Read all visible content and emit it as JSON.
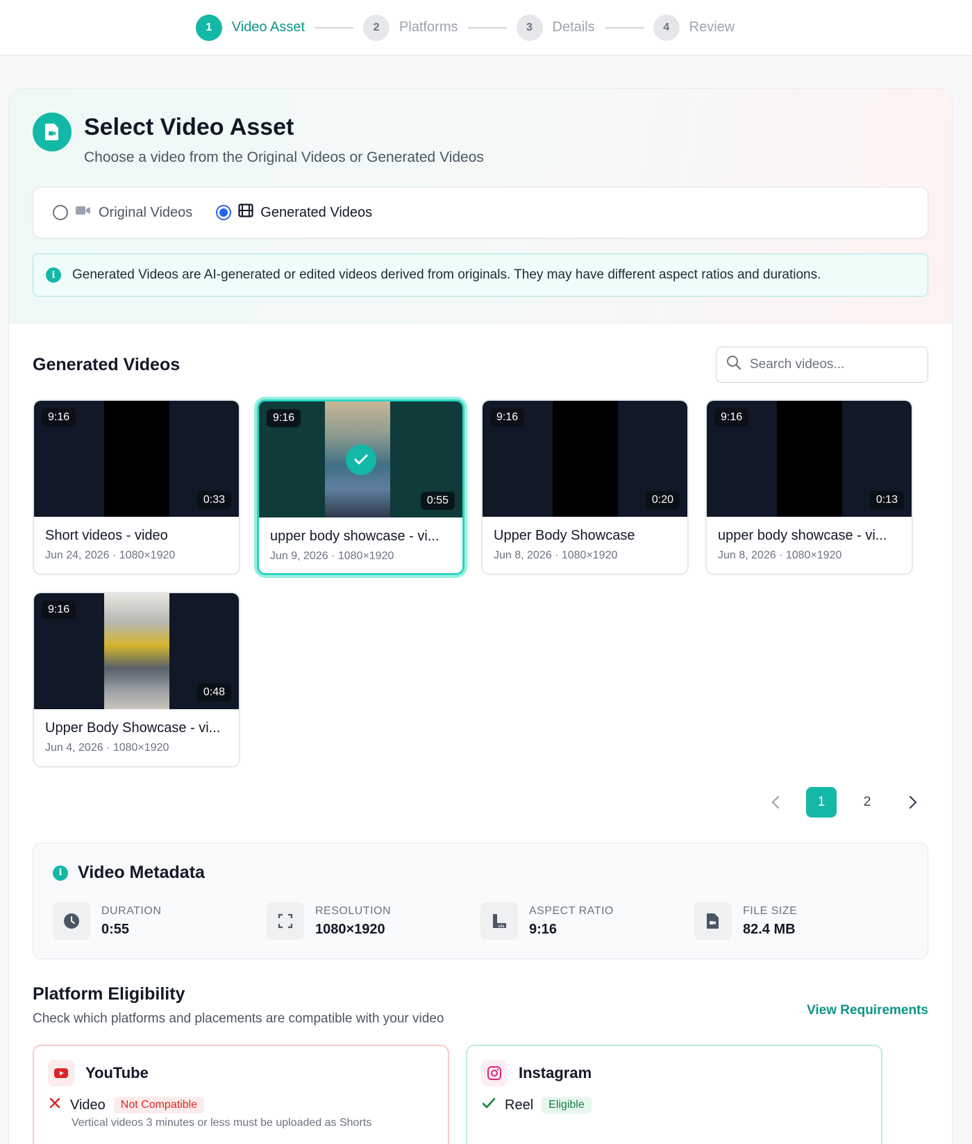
{
  "stepper": [
    {
      "num": "1",
      "label": "Video Asset",
      "active": true
    },
    {
      "num": "2",
      "label": "Platforms",
      "active": false
    },
    {
      "num": "3",
      "label": "Details",
      "active": false
    },
    {
      "num": "4",
      "label": "Review",
      "active": false
    }
  ],
  "hero": {
    "title": "Select Video Asset",
    "subtitle": "Choose a video from the Original Videos or Generated Videos"
  },
  "source": {
    "original_label": "Original Videos",
    "generated_label": "Generated Videos",
    "selected": "generated"
  },
  "info_banner": "Generated Videos are AI-generated or edited videos derived from originals. They may have different aspect ratios and durations.",
  "generated": {
    "title": "Generated Videos",
    "search_placeholder": "Search videos...",
    "videos": [
      {
        "name": "Short videos - video",
        "meta": "Jun 24, 2026 · 1080×1920",
        "aspect": "9:16",
        "duration": "0:33"
      },
      {
        "name": "upper body showcase - vi...",
        "meta": "Jun 9, 2026 · 1080×1920",
        "aspect": "9:16",
        "duration": "0:55",
        "selected": true
      },
      {
        "name": "Upper Body Showcase",
        "meta": "Jun 8, 2026 · 1080×1920",
        "aspect": "9:16",
        "duration": "0:20"
      },
      {
        "name": "upper body showcase - vi...",
        "meta": "Jun 8, 2026 · 1080×1920",
        "aspect": "9:16",
        "duration": "0:13"
      },
      {
        "name": "Upper Body Showcase - vi...",
        "meta": "Jun 4, 2026 · 1080×1920",
        "aspect": "9:16",
        "duration": "0:48"
      }
    ]
  },
  "pagination": {
    "pages": [
      "1",
      "2"
    ],
    "current": "1"
  },
  "metadata": {
    "title": "Video Metadata",
    "items": [
      {
        "label": "DURATION",
        "value": "0:55",
        "icon": "clock-icon"
      },
      {
        "label": "RESOLUTION",
        "value": "1080×1920",
        "icon": "expand-icon"
      },
      {
        "label": "ASPECT RATIO",
        "value": "9:16",
        "icon": "ruler-icon"
      },
      {
        "label": "FILE SIZE",
        "value": "82.4 MB",
        "icon": "file-icon"
      }
    ]
  },
  "eligibility": {
    "title": "Platform Eligibility",
    "subtitle": "Check which platforms and placements are compatible with your video",
    "view_requirements": "View Requirements",
    "youtube": {
      "name": "YouTube",
      "placement": "Video",
      "status": "Not Compatible",
      "note": "Vertical videos 3 minutes or less must be uploaded as Shorts"
    },
    "instagram": {
      "name": "Instagram",
      "placement": "Reel",
      "status": "Eligible"
    }
  },
  "colors": {
    "accent": "#14b8a6",
    "radio": "#2563eb",
    "error": "#dc2626",
    "success": "#15803d"
  }
}
